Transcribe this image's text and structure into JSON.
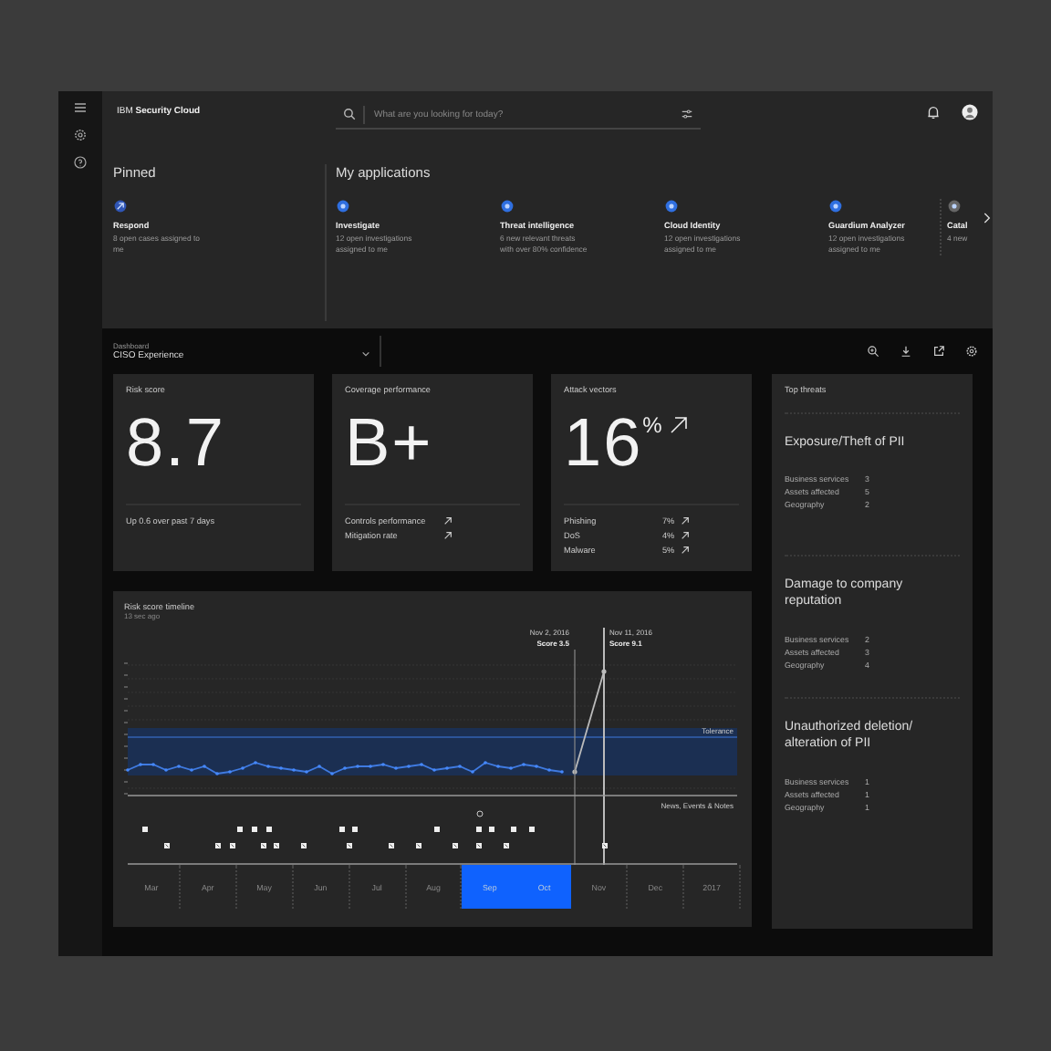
{
  "header": {
    "brand_light": "IBM",
    "brand_bold": "Security Cloud",
    "search": {
      "placeholder": "What are you looking for today?"
    }
  },
  "pinned": {
    "title": "Pinned",
    "apps": [
      {
        "name": "Respond",
        "desc": "8 open cases assigned to me"
      }
    ]
  },
  "my_applications": {
    "title": "My applications",
    "apps": [
      {
        "name": "Investigate",
        "desc": "12 open investigations assigned to me"
      },
      {
        "name": "Threat intelligence",
        "desc": "6 new relevant threats with over 80% confidence"
      },
      {
        "name": "Cloud Identity",
        "desc": "12 open investigations assigned to me"
      },
      {
        "name": "Guardium Analyzer",
        "desc": "12 open investigations assigned to me"
      },
      {
        "name": "Catal",
        "desc": "4 new"
      }
    ]
  },
  "dashboard": {
    "label": "Dashboard",
    "value": "CISO Experience"
  },
  "cards": [
    {
      "kind": "score",
      "title": "Risk score",
      "value": "8.7",
      "note": "Up 0.6 over past 7 days"
    },
    {
      "kind": "grade",
      "title": "Coverage performance",
      "value": "B+",
      "rows": [
        {
          "label": "Controls performance"
        },
        {
          "label": "Mitigation rate"
        }
      ]
    },
    {
      "kind": "percent",
      "title": "Attack vectors",
      "value": "16",
      "unit": "%",
      "rows": [
        {
          "label": "Phishing",
          "value": "7%"
        },
        {
          "label": "DoS",
          "value": "4%"
        },
        {
          "label": "Malware",
          "value": "5%"
        }
      ]
    }
  ],
  "top_threats": {
    "title": "Top threats",
    "threats": [
      {
        "title": "Exposure/Theft of PII",
        "stats": [
          {
            "label": "Business services",
            "value": "3"
          },
          {
            "label": "Assets affected",
            "value": "5"
          },
          {
            "label": "Geography",
            "value": "2"
          }
        ]
      },
      {
        "title": "Damage to company reputation",
        "stats": [
          {
            "label": "Business services",
            "value": "2"
          },
          {
            "label": "Assets affected",
            "value": "3"
          },
          {
            "label": "Geography",
            "value": "4"
          }
        ]
      },
      {
        "title": "Unauthorized deletion/ alteration of PII",
        "stats": [
          {
            "label": "Business services",
            "value": "1"
          },
          {
            "label": "Assets affected",
            "value": "1"
          },
          {
            "label": "Geography",
            "value": "1"
          }
        ]
      }
    ]
  },
  "timeline": {
    "title": "Risk score timeline",
    "subtitle": "13 sec ago",
    "markers": [
      {
        "date": "Nov 2, 2016",
        "score": "Score 3.5"
      },
      {
        "date": "Nov 11, 2016",
        "score": "Score 9.1"
      }
    ],
    "band_label": "Tolerance",
    "events_label": "News, Events & Notes",
    "months": [
      {
        "label": "Mar",
        "selected": false
      },
      {
        "label": "Apr",
        "selected": false
      },
      {
        "label": "May",
        "selected": false
      },
      {
        "label": "Jun",
        "selected": false
      },
      {
        "label": "Jul",
        "selected": false
      },
      {
        "label": "Aug",
        "selected": false
      },
      {
        "label": "Sep",
        "selected": true
      },
      {
        "label": "Oct",
        "selected": true
      },
      {
        "label": "Nov",
        "selected": false
      },
      {
        "label": "Dec",
        "selected": false
      },
      {
        "label": "2017",
        "selected": false
      }
    ]
  }
}
